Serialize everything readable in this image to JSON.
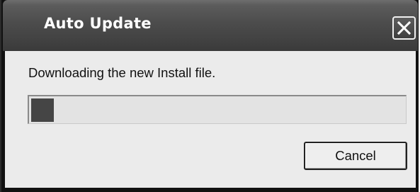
{
  "window": {
    "title": "Auto Update",
    "close_icon": "close-icon"
  },
  "dialog": {
    "message": "Downloading the new Install file.",
    "progress_fraction": 0.06,
    "cancel_label": "Cancel"
  },
  "colors": {
    "titlebar": "#4c4c4c",
    "client_background": "#ebebeb",
    "progress_fill": "#454545"
  }
}
